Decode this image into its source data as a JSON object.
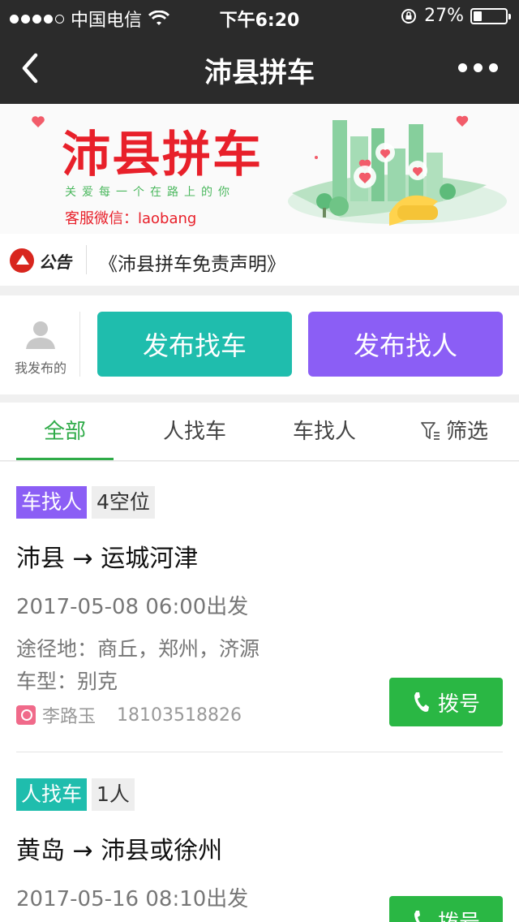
{
  "status_bar": {
    "carrier": "中国电信",
    "time": "下午6:20",
    "battery_percent": "27%",
    "battery_level": 0.27,
    "signal_bars_filled": 4
  },
  "nav": {
    "title": "沛县拼车",
    "back_icon": "chevron-left-icon",
    "more_icon": "more-dots-icon"
  },
  "banner": {
    "title": "沛县拼车",
    "subtitle": "关爱每一个在路上的你",
    "contact": "客服微信：laobang"
  },
  "notice": {
    "label": "公告",
    "text": "《沛县拼车免责声明》"
  },
  "actions": {
    "my_posts_label": "我发布的",
    "find_car_label": "发布找车",
    "find_person_label": "发布找人"
  },
  "tabs": [
    {
      "label": "全部",
      "active": true
    },
    {
      "label": "人找车",
      "active": false
    },
    {
      "label": "车找人",
      "active": false
    },
    {
      "label": "筛选",
      "active": false
    }
  ],
  "listings": [
    {
      "type": "车找人",
      "seats": "4空位",
      "route": "沛县 → 运城河津",
      "departure": "2017-05-08 06:00出发",
      "via": "途径地：商丘，郑州，济源",
      "car_model": "车型：别克",
      "contact_name": "李路玉",
      "phone": "18103518826",
      "dial_label": "拨号"
    },
    {
      "type": "人找车",
      "seats": "1人",
      "route": "黄岛 → 沛县或徐州",
      "departure": "2017-05-16 08:10出发",
      "dial_label": "拨号"
    }
  ],
  "colors": {
    "nav_bg": "#2b2b2b",
    "brand_red": "#e8202a",
    "accent_green": "#2eab48",
    "teal": "#1fbdad",
    "purple": "#8b5ef5",
    "dial_green": "#2ab744"
  }
}
